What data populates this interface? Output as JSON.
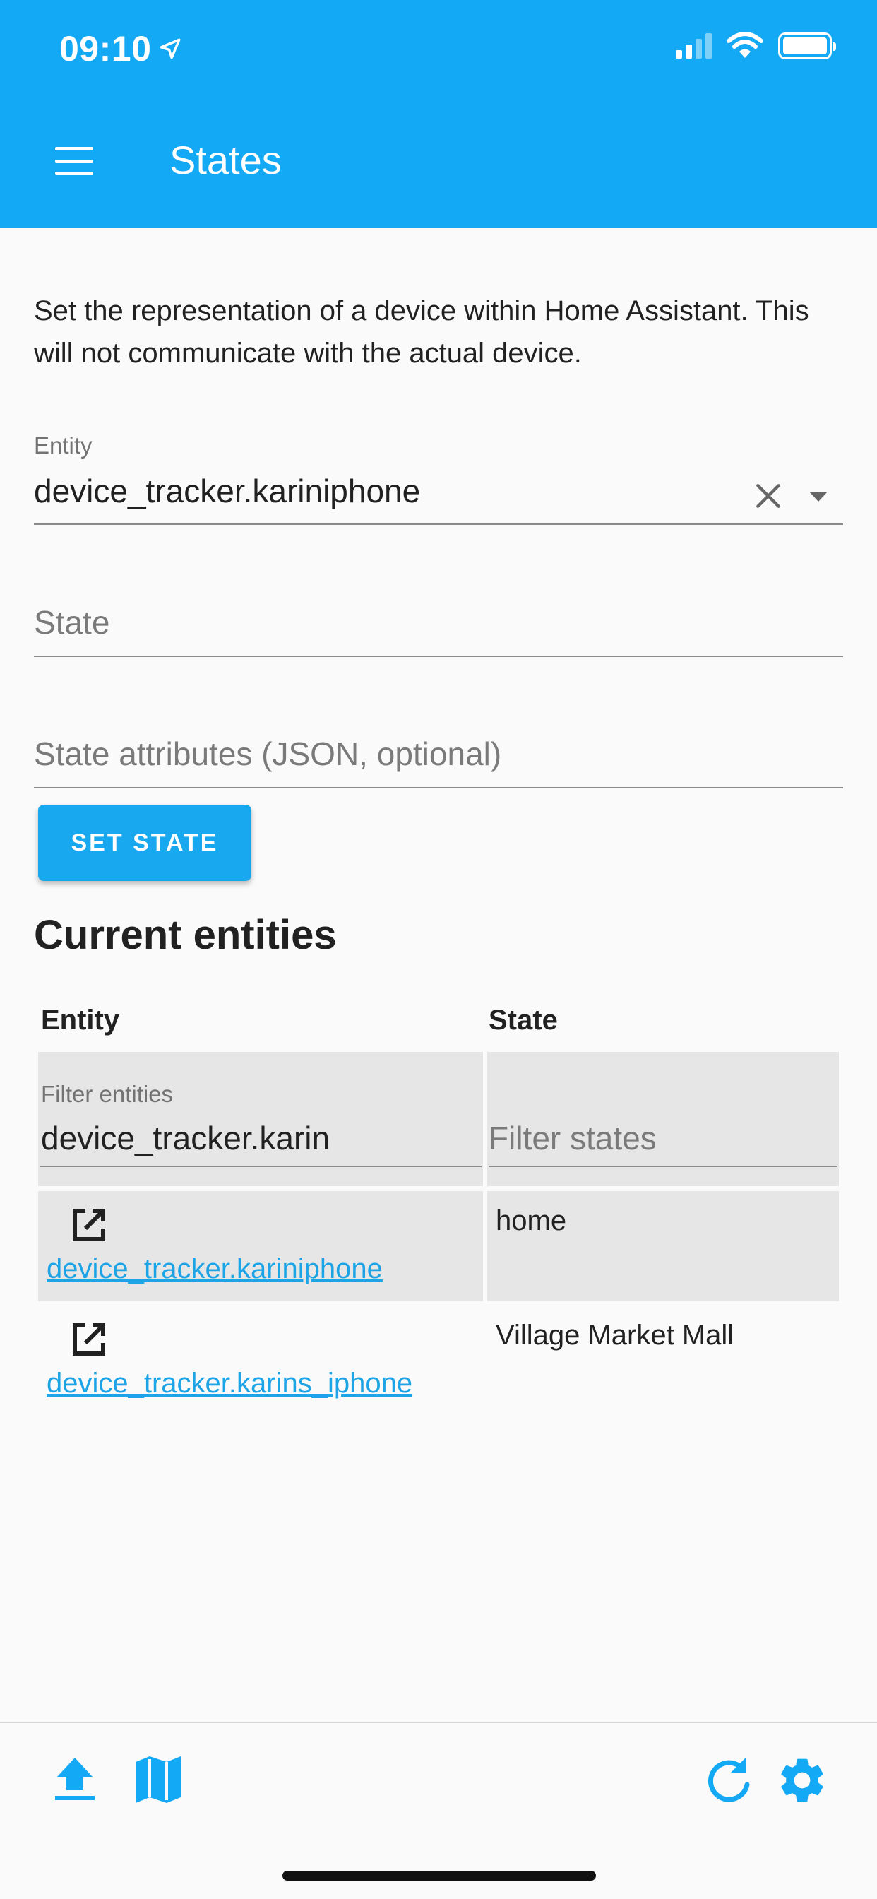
{
  "status_bar": {
    "time": "09:10"
  },
  "header": {
    "title": "States"
  },
  "description": "Set the representation of a device within Home Assistant. This will not communicate with the actual device.",
  "entity_field": {
    "label": "Entity",
    "value": "device_tracker.kariniphone"
  },
  "state_field": {
    "placeholder": "State"
  },
  "attributes_field": {
    "placeholder": "State attributes (JSON, optional)"
  },
  "set_state_button": {
    "label": "SET STATE"
  },
  "current_entities": {
    "title": "Current entities",
    "columns": [
      "Entity",
      "State"
    ],
    "filter_entities": {
      "label": "Filter entities",
      "value": "device_tracker.karin"
    },
    "filter_states": {
      "placeholder": "Filter states"
    },
    "rows": [
      {
        "entity": "device_tracker.kariniphone",
        "state": "home"
      },
      {
        "entity": "device_tracker.karins_iphone",
        "state": "Village Market Mall"
      }
    ]
  },
  "colors": {
    "accent": "#14a9f4",
    "link": "#1da4e6"
  },
  "toolbar": {
    "icons": [
      "upload-icon",
      "map-icon",
      "refresh-icon",
      "settings-icon"
    ]
  }
}
